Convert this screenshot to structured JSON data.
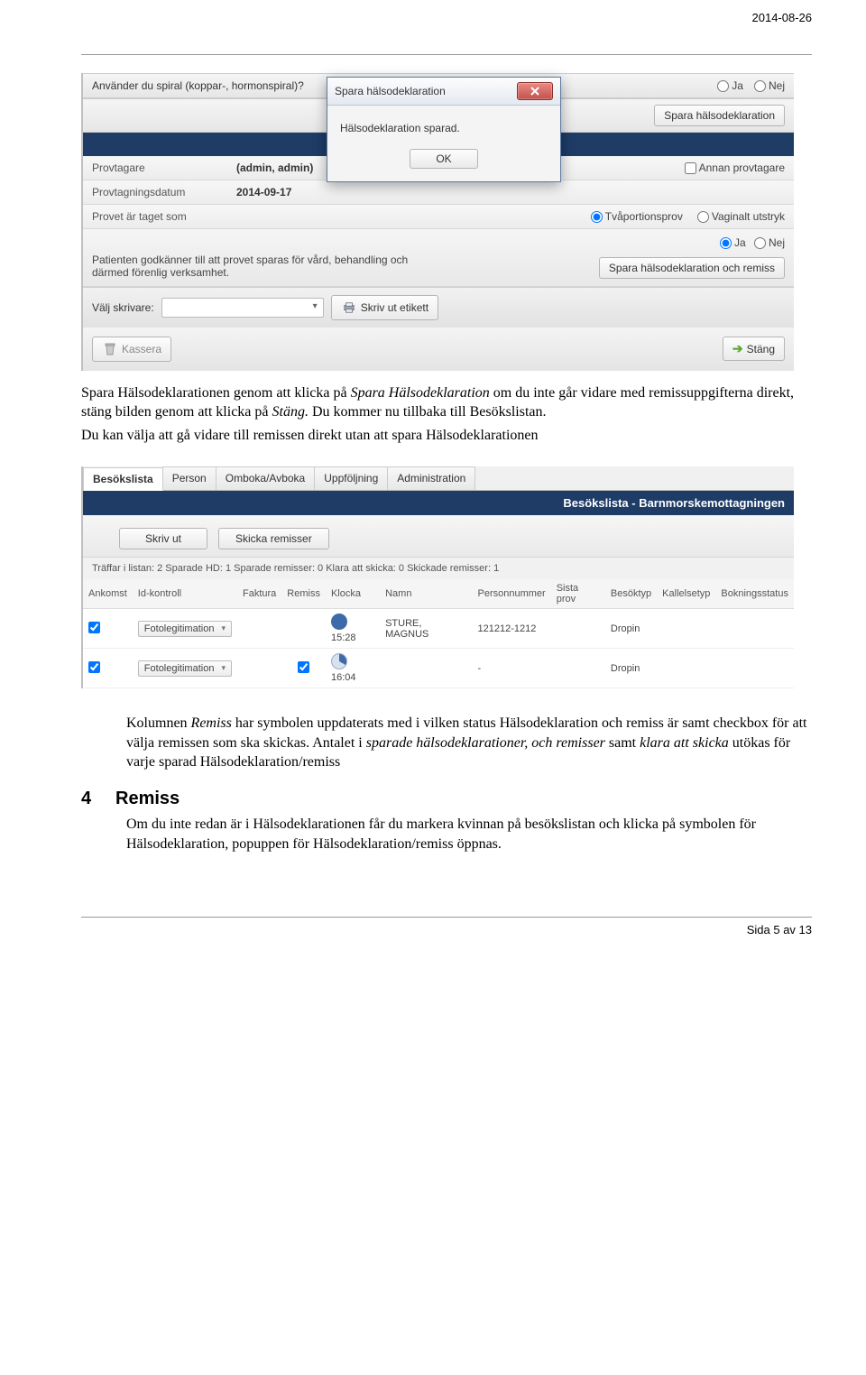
{
  "header_date": "2014-08-26",
  "ui1": {
    "q_spiral": "Använder du spiral (koppar-, hormonspiral)?",
    "ja": "Ja",
    "nej": "Nej",
    "spara_hd": "Spara hälsodeklaration",
    "modal_title": "Spara hälsodeklaration",
    "modal_msg": "Hälsodeklaration sparad.",
    "modal_ok": "OK",
    "provtagare_lbl": "Provtagare",
    "provtagare_val": "(admin, admin)",
    "annan_prov": "Annan provtagare",
    "provdatum_lbl": "Provtagningsdatum",
    "provdatum_val": "2014-09-17",
    "provet_lbl": "Provet är taget som",
    "tvaport": "Tvåportionsprov",
    "vaginalt": "Vaginalt utstryk",
    "consent_text": "Patienten godkänner till att provet sparas för vård, behandling och därmed förenlig verksamhet.",
    "spara_hd_remiss": "Spara hälsodeklaration och remiss",
    "valj_skrivare": "Välj skrivare:",
    "skriv_etikett": "Skriv ut etikett",
    "kassera": "Kassera",
    "stang": "Stäng"
  },
  "para1_a": "Spara Hälsodeklarationen genom att klicka på ",
  "para1_b": "Spara Hälsodeklaration",
  "para1_c": " om du inte går vidare med remissuppgifterna direkt, stäng bilden genom att klicka på ",
  "para1_d": "Stäng.",
  "para1_e": " Du kommer nu tillbaka till Besökslistan.",
  "para2": "Du kan välja att gå vidare till remissen direkt utan att spara Hälsodeklarationen",
  "ui2": {
    "tabs": [
      "Besökslista",
      "Person",
      "Omboka/Avboka",
      "Uppföljning",
      "Administration"
    ],
    "title": "Besökslista - Barnmorskemottagningen",
    "skriv_ut": "Skriv ut",
    "skicka_rem": "Skicka remisser",
    "stats": "Träffar i listan:  2   Sparade HD:  1   Sparade remisser:  0   Klara att skicka:  0   Skickade remisser:  1",
    "cols": [
      "Ankomst",
      "Id-kontroll",
      "Faktura",
      "Remiss",
      "Klocka",
      "Namn",
      "Personnummer",
      "Sista prov",
      "Besöktyp",
      "Kallelsetyp",
      "Bokningsstatus"
    ],
    "row1": {
      "idk": "Fotolegitimation",
      "tid": "15:28",
      "namn": "STURE, MAGNUS",
      "pnr": "121212-1212",
      "besok": "Dropin"
    },
    "row2": {
      "idk": "Fotolegitimation",
      "tid": "16:04",
      "namn": "",
      "pnr": "-",
      "besok": "Dropin"
    }
  },
  "para3_a": "Kolumnen ",
  "para3_b": "Remiss",
  "para3_c": " har symbolen uppdaterats med i vilken status Hälsodeklaration och remiss är samt checkbox för att välja remissen som ska skickas. Antalet i ",
  "para3_d": "sparade hälsodeklarationer, och remisser",
  "para3_e": " samt ",
  "para3_f": "klara att skicka",
  "para3_g": " utökas för varje sparad Hälsodeklaration/remiss",
  "sect_num": "4",
  "sect_title": "Remiss",
  "para4": "Om du inte redan är i Hälsodeklarationen får du markera kvinnan på besökslistan och klicka på symbolen för Hälsodeklaration, popuppen för Hälsodeklaration/remiss öppnas.",
  "footer": "Sida 5 av 13"
}
